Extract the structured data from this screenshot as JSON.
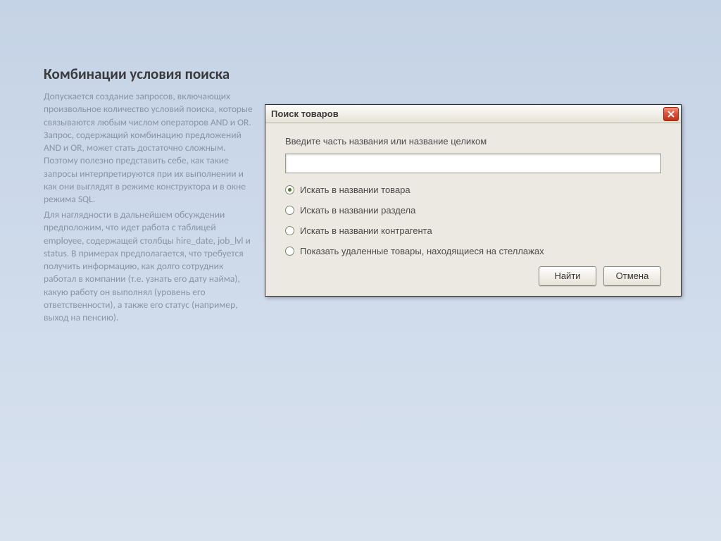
{
  "article": {
    "heading": "Комбинации условия поиска",
    "para1": "Допускается создание запросов, включающих произвольное количество условий поиска, которые связываются любым числом операторов AND и OR. Запрос, содержащий комбинацию предложений AND и OR, может стать достаточно сложным. Поэтому полезно представить себе, как такие запросы интерпретируются при их выполнении и как они выглядят в режиме конструктора и в окне режима SQL.",
    "para2": "Для наглядности в дальнейшем обсуждении предположим, что идет работа с таблицей employee, содержащей столбцы hire_date, job_lvl и status. В примерах предполагается, что требуется получить информацию, как долго сотрудник работал в компании (т.е. узнать его дату найма), какую работу он выполнял (уровень его ответственности), а также его статус (например, выход на пенсию)."
  },
  "dialog": {
    "title": "Поиск товаров",
    "prompt": "Введите часть названия или название целиком",
    "input_value": "",
    "radios": [
      {
        "label": "Искать в названии товара",
        "checked": true
      },
      {
        "label": "Искать в названии раздела",
        "checked": false
      },
      {
        "label": "Искать в названии контрагента",
        "checked": false
      },
      {
        "label": "Показать удаленные товары, находящиеся на стеллажах",
        "checked": false
      }
    ],
    "buttons": {
      "find": "Найти",
      "cancel": "Отмена"
    }
  }
}
